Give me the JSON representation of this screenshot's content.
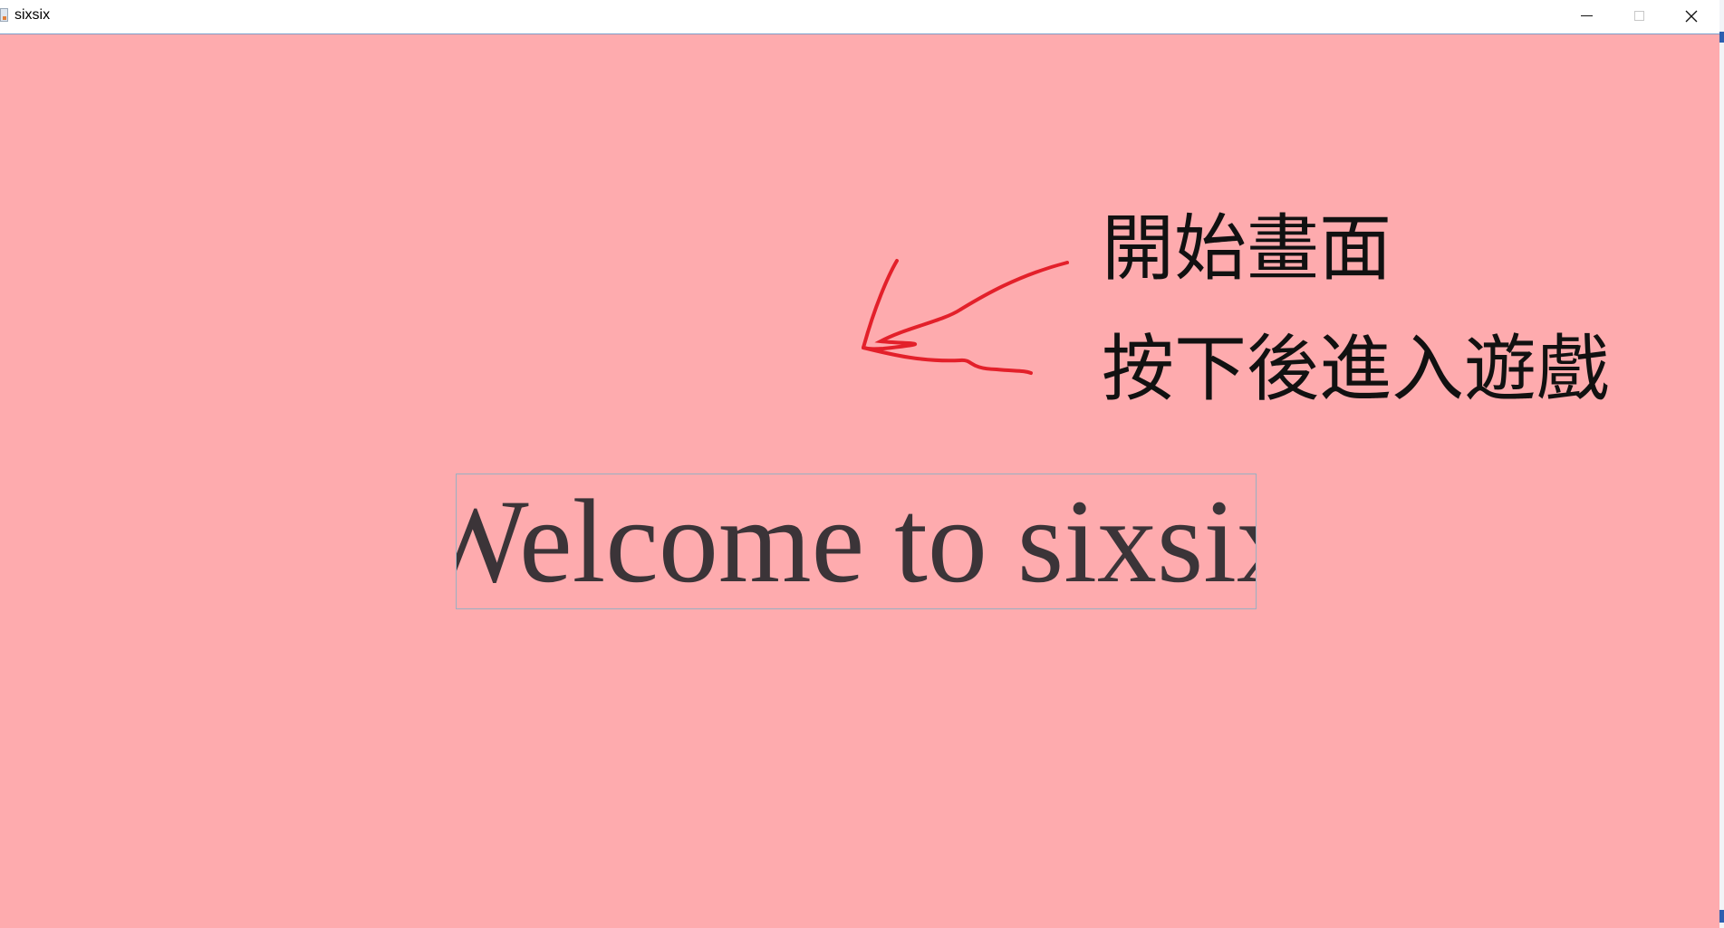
{
  "window": {
    "title": "sixsix",
    "app_icon": "java-app-icon",
    "controls": {
      "minimize_icon": "minimize-icon",
      "maximize_icon": "maximize-icon",
      "close_icon": "close-icon",
      "close_glyph": "✕"
    },
    "background_color": "#feabae"
  },
  "annotation": {
    "line1": "開始畫面",
    "line2": "按下後進入遊戲",
    "arrow_icon": "hand-drawn-arrow-icon",
    "arrow_color": "#e3202a"
  },
  "main": {
    "start_button_label": "Welcome to sixsix"
  }
}
